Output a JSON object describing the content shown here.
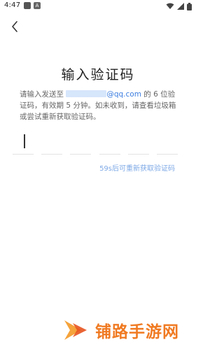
{
  "status_bar": {
    "time": "4:47",
    "left_icons": [
      "notification-icon",
      "keyboard-a-icon"
    ],
    "right_icons": [
      "wifi-icon",
      "signal-icon",
      "battery-icon"
    ]
  },
  "page": {
    "title": "输入验证码",
    "description_prefix": "请输入发送至",
    "email_suffix": "@qq.com",
    "description_suffix": "的 6 位验证码，有效期 5 分钟。如未收到，请查看垃圾箱或尝试重新获取验证码。",
    "code_length": 6,
    "code_values": [
      "",
      "",
      "",
      "",
      "",
      ""
    ],
    "resend_text": "59s后可重新获取验证码"
  },
  "watermark": {
    "text": "铺路手游网"
  },
  "colors": {
    "accent": "#3b7de0",
    "resend": "#7ea9e6",
    "watermark": "#f07a22"
  }
}
